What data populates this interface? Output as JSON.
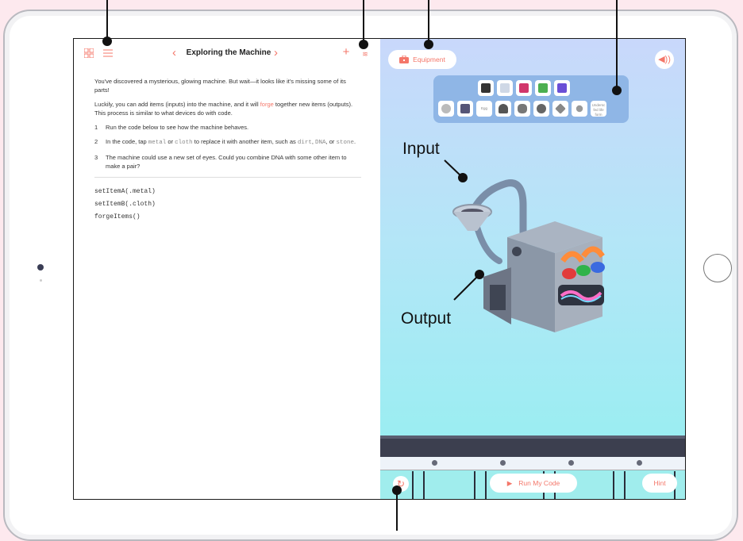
{
  "left_panel": {
    "title": "Exploring the Machine",
    "paragraph1": "You've discovered a mysterious, glowing machine. But wait—it looks like it's missing some of its parts!",
    "paragraph2_a": "Luckily, you can add items (inputs) into the machine, and it will ",
    "paragraph2_forge": "forge",
    "paragraph2_b": " together new items (outputs). This process is similar to what devices do with code.",
    "steps": [
      {
        "num": "1",
        "text": "Run the code below to see how the machine behaves."
      },
      {
        "num": "2",
        "text_a": "In the code, tap ",
        "code1": "metal",
        "text_b": " or ",
        "code2": "cloth",
        "text_c": " to replace it with another item, such as ",
        "code3": "dirt",
        "text_d": ", ",
        "code4": "DNA",
        "text_e": ", or ",
        "code5": "stone",
        "text_f": "."
      },
      {
        "num": "3",
        "text": "The machine could use a new set of eyes. Could you combine DNA with some other item to make a pair?"
      }
    ],
    "code_lines": [
      "setItemA(.metal)",
      "setItemB(.cloth)",
      "forgeItems()"
    ],
    "add_label": "+",
    "bookmark_label": "≋"
  },
  "right_panel": {
    "equipment_label": "Equipment",
    "run_label": "Run My Code",
    "hint_label": "Hint",
    "toolbox_note": "Undersc fed life form",
    "toolbox_egg": "Egg"
  },
  "callouts": {
    "input": "Input",
    "output": "Output"
  },
  "colors": {
    "accent": "#f4776a",
    "sky_top": "#c9d8fb",
    "sky_bottom": "#93f0f0"
  },
  "icons": {
    "grid": "grid-icon",
    "list": "list-icon",
    "prev": "chevron-left-icon",
    "next": "chevron-right-icon",
    "toolbox": "toolbox-icon",
    "sound": "speaker-icon",
    "reset": "reset-icon",
    "play": "play-icon"
  }
}
